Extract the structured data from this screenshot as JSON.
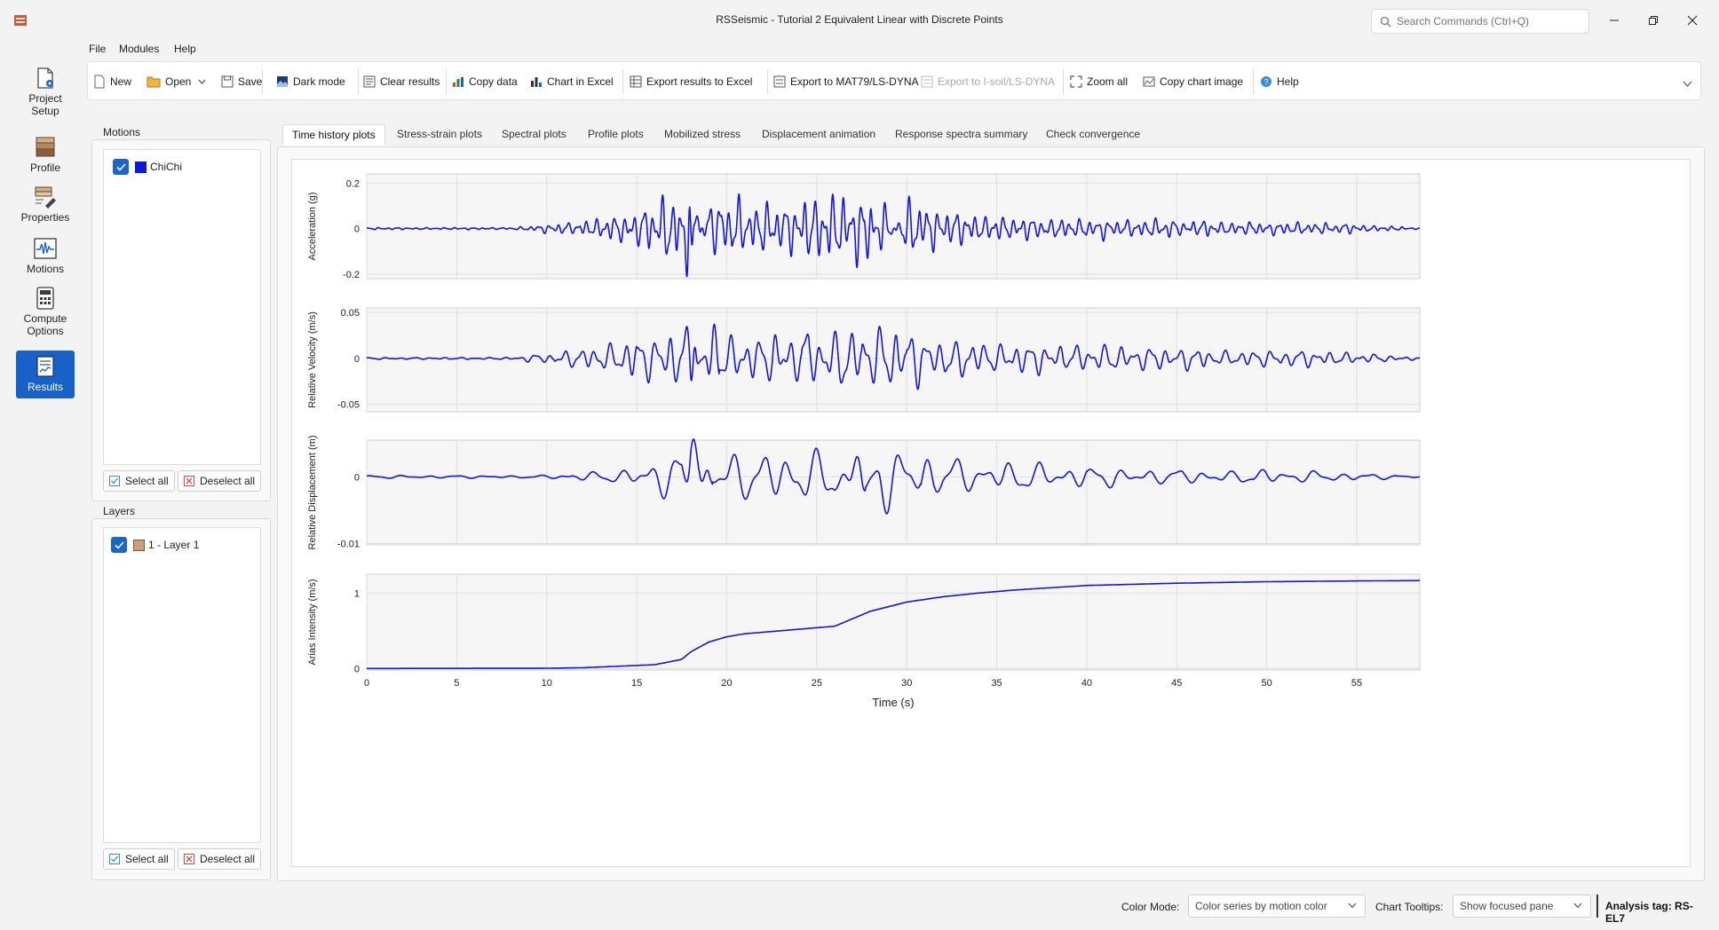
{
  "window": {
    "title": "RSSeismic - Tutorial 2 Equivalent Linear with Discrete Points",
    "search_placeholder": "Search Commands (Ctrl+Q)"
  },
  "nav": [
    {
      "label1": "Project",
      "label2": "Setup",
      "icon": "project-setup-icon",
      "active": false
    },
    {
      "label1": "Profile",
      "label2": "",
      "icon": "profile-icon",
      "active": false
    },
    {
      "label1": "Properties",
      "label2": "",
      "icon": "properties-icon",
      "active": false
    },
    {
      "label1": "Motions",
      "label2": "",
      "icon": "motions-icon",
      "active": false
    },
    {
      "label1": "Compute",
      "label2": "Options",
      "icon": "compute-icon",
      "active": false
    },
    {
      "label1": "Results",
      "label2": "",
      "icon": "results-icon",
      "active": true
    }
  ],
  "menu": [
    "File",
    "Modules",
    "Help"
  ],
  "toolbar": {
    "new": "New",
    "open": "Open",
    "save": "Save",
    "dark_mode": "Dark mode",
    "clear_results": "Clear results",
    "copy_data": "Copy data",
    "chart_excel": "Chart in Excel",
    "export_excel": "Export results to Excel",
    "export_mat79": "Export to MAT79/LS-DYNA",
    "export_isoil": "Export to I-soil/LS-DYNA",
    "zoom_all": "Zoom all",
    "copy_chart": "Copy chart image",
    "help": "Help"
  },
  "motions_panel": {
    "title": "Motions",
    "items": [
      {
        "label": "ChiChi",
        "color": "#0a1ad6",
        "checked": true
      }
    ],
    "select_all": "Select all",
    "deselect_all": "Deselect all"
  },
  "layers_panel": {
    "title": "Layers",
    "items": [
      {
        "label": "1 - Layer 1",
        "color": "#c8a07a",
        "checked": true
      }
    ],
    "select_all": "Select all",
    "deselect_all": "Deselect all"
  },
  "tabs": [
    {
      "label": "Time history plots",
      "active": true
    },
    {
      "label": "Stress-strain plots",
      "active": false
    },
    {
      "label": "Spectral plots",
      "active": false
    },
    {
      "label": "Profile plots",
      "active": false
    },
    {
      "label": "Mobilized stress",
      "active": false
    },
    {
      "label": "Displacement animation",
      "active": false
    },
    {
      "label": "Response spectra summary",
      "active": false
    },
    {
      "label": "Check convergence",
      "active": false
    }
  ],
  "status": {
    "color_mode_label": "Color Mode:",
    "color_mode_value": "Color series by motion color",
    "tooltips_label": "Chart Tooltips:",
    "tooltips_value": "Show focused pane",
    "analysis_tag": "Analysis tag: RS-EL7"
  },
  "chart_data": {
    "type": "line",
    "xlabel": "Time (s)",
    "x_ticks": [
      0,
      5,
      10,
      15,
      20,
      25,
      30,
      35,
      40,
      45,
      50,
      55
    ],
    "xlim": [
      0,
      58.5
    ],
    "series_color": "#1414e6",
    "panels": [
      {
        "ylabel": "Acceleration (g)",
        "ylim": [
          -0.22,
          0.24
        ],
        "y_ticks": [
          -0.2,
          0,
          0.2
        ],
        "kind": "oscillation",
        "peaks": [
          [
            8,
            0.004
          ],
          [
            12,
            0.03
          ],
          [
            14,
            0.06
          ],
          [
            16,
            0.1
          ],
          [
            17.5,
            0.15
          ],
          [
            17.9,
            0.2
          ],
          [
            18.1,
            -0.18
          ],
          [
            19,
            0.14
          ],
          [
            20,
            0.12
          ],
          [
            22,
            0.1
          ],
          [
            25,
            0.12
          ],
          [
            26,
            0.15
          ],
          [
            28,
            0.13
          ],
          [
            28.5,
            -0.15
          ],
          [
            30,
            0.12
          ],
          [
            32,
            0.07
          ],
          [
            35,
            0.06
          ],
          [
            40,
            0.04
          ],
          [
            45,
            0.035
          ],
          [
            50,
            0.025
          ],
          [
            55,
            0.02
          ],
          [
            58.5,
            0.002
          ]
        ]
      },
      {
        "ylabel": "Relative Velocity (m/s)",
        "ylim": [
          -0.058,
          0.055
        ],
        "y_ticks": [
          -0.05,
          0,
          0.05
        ],
        "kind": "oscillation",
        "peaks": [
          [
            8,
            0.001
          ],
          [
            12,
            0.01
          ],
          [
            14,
            0.02
          ],
          [
            16,
            0.028
          ],
          [
            17.5,
            0.035
          ],
          [
            18,
            0.045
          ],
          [
            18.3,
            -0.045
          ],
          [
            19,
            0.038
          ],
          [
            20,
            0.028
          ],
          [
            22,
            0.026
          ],
          [
            25,
            0.03
          ],
          [
            26,
            0.036
          ],
          [
            27,
            0.034
          ],
          [
            28,
            0.035
          ],
          [
            30,
            0.028
          ],
          [
            32,
            0.022
          ],
          [
            35,
            0.017
          ],
          [
            40,
            0.013
          ],
          [
            45,
            0.011
          ],
          [
            50,
            0.009
          ],
          [
            55,
            0.006
          ],
          [
            58.5,
            0.001
          ]
        ]
      },
      {
        "ylabel": "Relative Displacement (m)",
        "ylim": [
          -0.0102,
          0.0055
        ],
        "y_ticks": [
          -0.01,
          0
        ],
        "kind": "oscillation",
        "peaks": [
          [
            10,
            0.0002
          ],
          [
            12,
            0.0008
          ],
          [
            14,
            0.0012
          ],
          [
            16,
            0.0025
          ],
          [
            17.5,
            0.004
          ],
          [
            18,
            -0.009
          ],
          [
            19,
            0.003
          ],
          [
            21,
            0.003
          ],
          [
            24,
            0.0035
          ],
          [
            26,
            0.0045
          ],
          [
            27.5,
            -0.006
          ],
          [
            28.5,
            0.005
          ],
          [
            30,
            0.004
          ],
          [
            32,
            0.0028
          ],
          [
            35,
            0.002
          ],
          [
            40,
            0.0016
          ],
          [
            45,
            0.0012
          ],
          [
            50,
            0.001
          ],
          [
            55,
            0.0006
          ],
          [
            58.5,
            0.0001
          ]
        ]
      },
      {
        "ylabel": "Arias Intensity (m/s)",
        "ylim": [
          -0.02,
          1.25
        ],
        "y_ticks": [
          0,
          1
        ],
        "kind": "cumulative",
        "points": [
          [
            0,
            0
          ],
          [
            10,
            0.003
          ],
          [
            12,
            0.01
          ],
          [
            14,
            0.03
          ],
          [
            16,
            0.05
          ],
          [
            17.5,
            0.12
          ],
          [
            18,
            0.22
          ],
          [
            19,
            0.35
          ],
          [
            20,
            0.42
          ],
          [
            21,
            0.46
          ],
          [
            23,
            0.5
          ],
          [
            25,
            0.54
          ],
          [
            26,
            0.56
          ],
          [
            27,
            0.66
          ],
          [
            28,
            0.76
          ],
          [
            29,
            0.82
          ],
          [
            30,
            0.88
          ],
          [
            32,
            0.95
          ],
          [
            34,
            1.0
          ],
          [
            36,
            1.04
          ],
          [
            40,
            1.1
          ],
          [
            45,
            1.13
          ],
          [
            50,
            1.15
          ],
          [
            55,
            1.16
          ],
          [
            58.5,
            1.165
          ]
        ]
      }
    ]
  }
}
